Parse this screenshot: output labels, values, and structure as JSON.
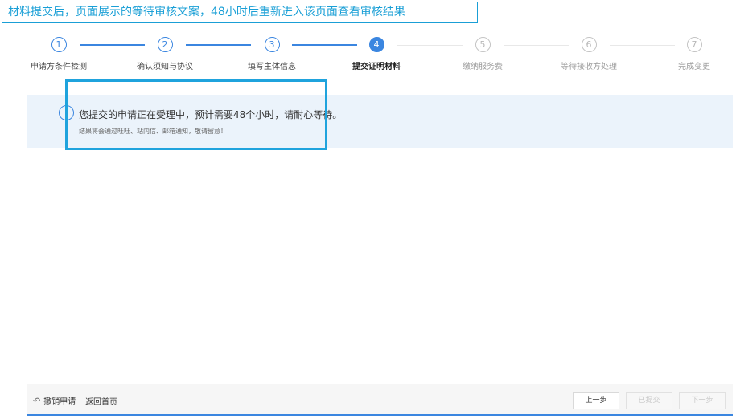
{
  "annotation": "材料提交后，页面展示的等待审核文案，48小时后重新进入该页面查看审核结果",
  "steps": [
    {
      "num": "1",
      "label": "申请方条件检测"
    },
    {
      "num": "2",
      "label": "确认须知与协议"
    },
    {
      "num": "3",
      "label": "填写主体信息"
    },
    {
      "num": "4",
      "label": "提交证明材料"
    },
    {
      "num": "5",
      "label": "缴纳服务费"
    },
    {
      "num": "6",
      "label": "等待接收方处理"
    },
    {
      "num": "7",
      "label": "完成变更"
    }
  ],
  "current_step": 4,
  "notice": {
    "icon_glyph": "!",
    "icon": "info-icon",
    "main": "您提交的申请正在受理中，预计需要48个小时，请耐心等待。",
    "sub": "结果将会通过旺旺、站内信、邮箱通知，敬请留意！"
  },
  "footer": {
    "undo_icon": "undo-arrow-icon",
    "undo_glyph": "↶",
    "undo": "撤销申请",
    "home": "返回首页",
    "prev": "上一步",
    "submitted": "已提交",
    "next": "下一步"
  },
  "colors": {
    "accent": "#3b86e0",
    "annotation": "#1a9fd6",
    "notice_bg": "#ebf3fb"
  }
}
